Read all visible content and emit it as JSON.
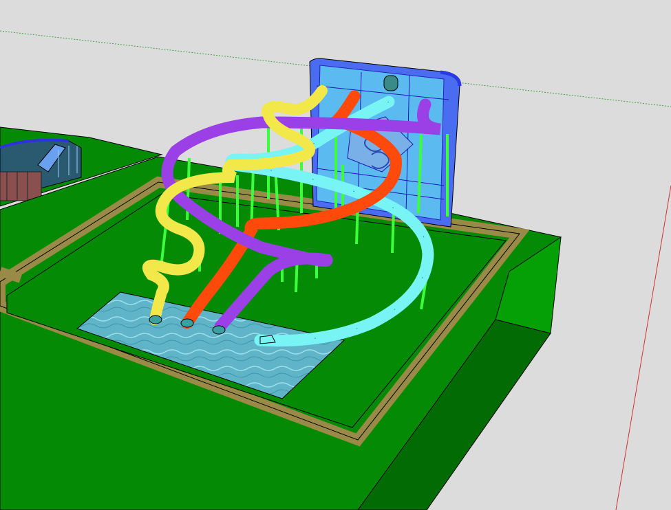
{
  "scene": {
    "kind": "3d-model-viewport",
    "colors": {
      "sky": "#dcdcdc",
      "grass": "#048a04",
      "grass_dark": "#036b03",
      "border": "#9a8a48",
      "water": "#5fb4c8",
      "tower": "#4a6cf0",
      "tower_glass": "#5ec8f0",
      "slide_yellow": "#f2e84a",
      "slide_purple": "#9b3fe6",
      "slide_red": "#ff4a0c",
      "slide_cyan": "#78f4f4",
      "support_green": "#3cff3c",
      "axis_red": "#d03030",
      "axis_green": "#3fa03f"
    },
    "objects": [
      "ground-platform",
      "pool",
      "tower",
      "slide-yellow",
      "slide-purple",
      "slide-red",
      "slide-cyan",
      "support-posts",
      "neighbor-structure"
    ]
  }
}
